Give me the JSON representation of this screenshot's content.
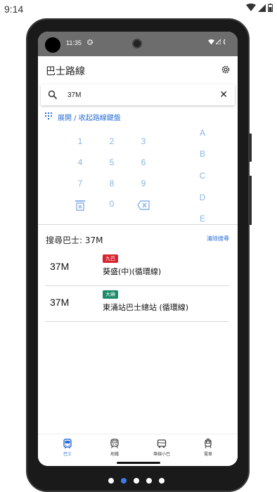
{
  "outer_status": {
    "time": "9:14"
  },
  "inner_status": {
    "time": "11:35"
  },
  "app": {
    "title": "巴士路線"
  },
  "search": {
    "value": "37M",
    "clear_symbol": "✕"
  },
  "keypad_toggle": {
    "label": "展開 / 收起路線鍵盤"
  },
  "keypad": {
    "digits": [
      "1",
      "2",
      "3",
      "4",
      "5",
      "6",
      "7",
      "8",
      "9",
      "0"
    ],
    "letters": [
      "A",
      "B",
      "C",
      "D",
      "E"
    ],
    "clear_icon": "trash-icon",
    "backspace_icon": "backspace-icon"
  },
  "results": {
    "title": "搜尋巴士: 37M",
    "clear_label": "清除搜尋",
    "items": [
      {
        "route": "37M",
        "operator": "九巴",
        "operator_color": "#d9232e",
        "destination": "葵盛(中)(循環線)"
      },
      {
        "route": "37M",
        "operator": "大嶼",
        "operator_color": "#1a8a68",
        "destination": "東涌站巴士總站 (循環線)"
      }
    ]
  },
  "nav": {
    "items": [
      {
        "label": "巴士",
        "icon": "bus-icon",
        "active": true
      },
      {
        "label": "地鐵",
        "icon": "metro-icon",
        "active": false
      },
      {
        "label": "專線小巴",
        "icon": "minibus-icon",
        "active": false
      },
      {
        "label": "電車",
        "icon": "tram-icon",
        "active": false
      }
    ]
  },
  "page_dots": {
    "count": 5,
    "active_index": 1
  },
  "colors": {
    "accent": "#2a6fd6",
    "keypad": "#8ab4e8",
    "status_bar": "#6d6d6d"
  }
}
